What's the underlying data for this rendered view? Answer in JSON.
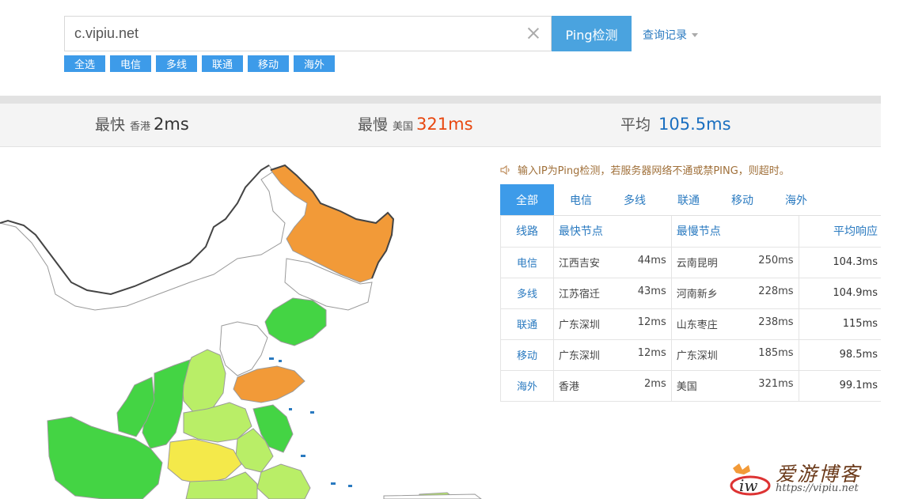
{
  "search": {
    "value": "c.vipiu.net",
    "button_label": "Ping检测",
    "history_label": "查询记录"
  },
  "filter_tags": [
    "全选",
    "电信",
    "多线",
    "联通",
    "移动",
    "海外"
  ],
  "stats": {
    "fastest": {
      "label": "最快",
      "location": "香港",
      "value": "2ms",
      "color": "#333333"
    },
    "slowest": {
      "label": "最慢",
      "location": "美国",
      "value": "321ms",
      "color": "#e8470f"
    },
    "average": {
      "label": "平均",
      "value": "105.5ms",
      "color": "#1a6fc0"
    }
  },
  "notice": "输入IP为Ping检测，若服务器网络不通或禁PING，则超时。",
  "tabs": [
    "全部",
    "电信",
    "多线",
    "联通",
    "移动",
    "海外"
  ],
  "table": {
    "headers": [
      "线路",
      "最快节点",
      "最慢节点",
      "平均响应"
    ],
    "rows": [
      {
        "line": "电信",
        "fast_node": "江西吉安",
        "fast_ms": "44ms",
        "slow_node": "云南昆明",
        "slow_ms": "250ms",
        "avg": "104.3ms"
      },
      {
        "line": "多线",
        "fast_node": "江苏宿迁",
        "fast_ms": "43ms",
        "slow_node": "河南新乡",
        "slow_ms": "228ms",
        "avg": "104.9ms"
      },
      {
        "line": "联通",
        "fast_node": "广东深圳",
        "fast_ms": "12ms",
        "slow_node": "山东枣庄",
        "slow_ms": "238ms",
        "avg": "115ms"
      },
      {
        "line": "移动",
        "fast_node": "广东深圳",
        "fast_ms": "12ms",
        "slow_node": "广东深圳",
        "slow_ms": "185ms",
        "avg": "98.5ms"
      },
      {
        "line": "海外",
        "fast_node": "香港",
        "fast_ms": "2ms",
        "slow_node": "美国",
        "slow_ms": "321ms",
        "avg": "99.1ms"
      }
    ]
  },
  "map_colors": {
    "orange": "#f29a38",
    "green": "#44d444",
    "light_green": "#b9ee67",
    "yellow": "#f4e94a",
    "gray_border": "#999999",
    "tab_blue": "#3d9be9"
  },
  "watermark": {
    "title": "爱游博客",
    "url": "https://vipiu.net"
  }
}
